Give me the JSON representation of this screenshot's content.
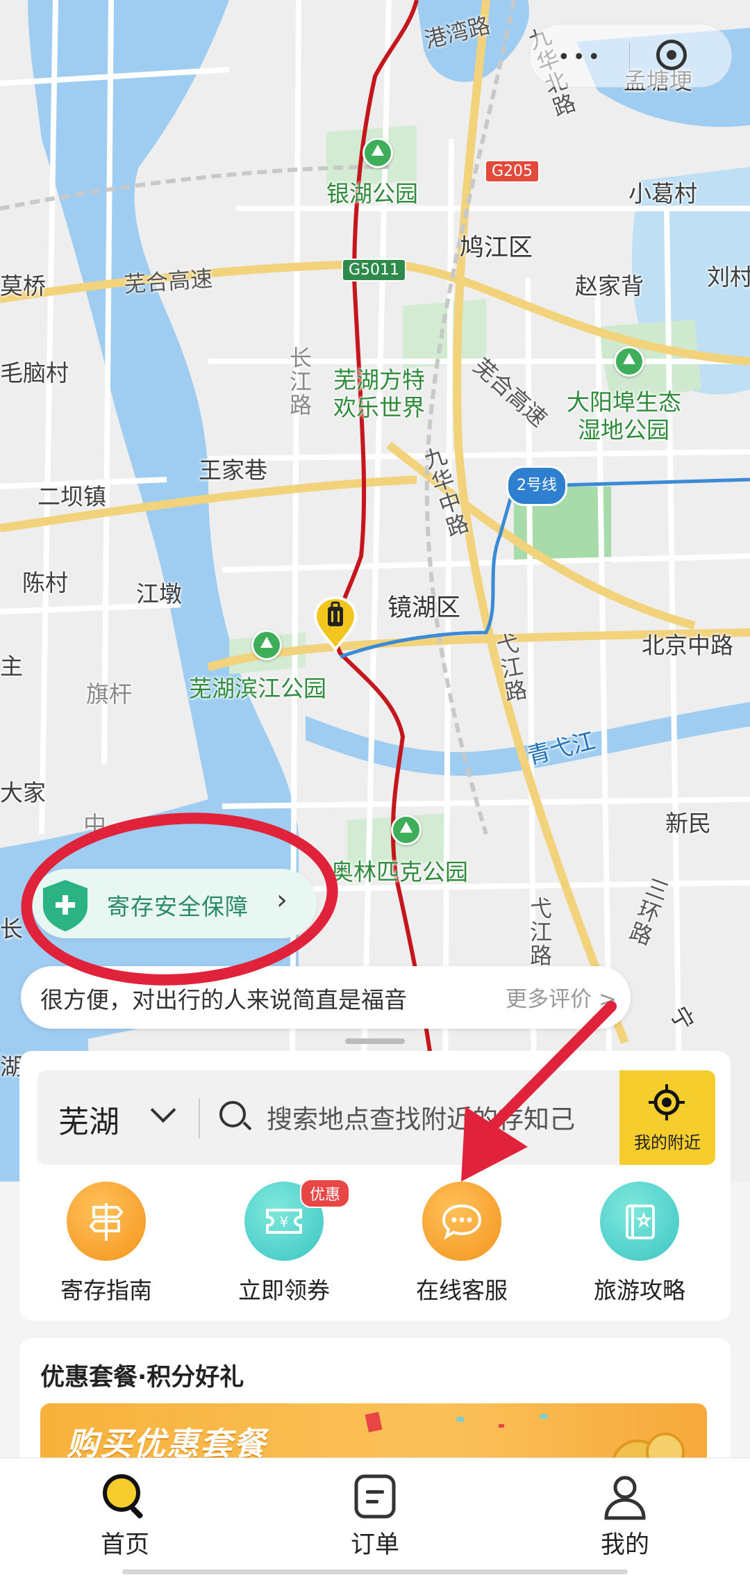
{
  "map": {
    "labels": {
      "ganwan_road": "港湾路",
      "jiuhua_north": "九华北路",
      "menggangdi": "孟塘埂",
      "yinhu_park": "银湖公园",
      "g205": "G205",
      "xiaogecun": "小葛村",
      "jiujiang_district": "鸠江区",
      "mo_qiao": "莫桥",
      "wuhe_highway": "芜合高速",
      "g5011": "G5011",
      "zhaojiabei": "赵家背",
      "liucun": "刘村",
      "maonao_cun": "毛脑村",
      "changjiang_road": "长江路",
      "fangte": "芜湖方特",
      "fangte2": "欢乐世界",
      "wuhe_highway2": "芜合高速",
      "dayangbu": "大阳埠生态",
      "dayangbu2": "湿地公园",
      "wangjiaxiang": "王家巷",
      "erba_town": "二坝镇",
      "jiuhua_middle": "九华中路",
      "metro_line2": "2号线",
      "chencun": "陈村",
      "jiangdun": "江墩",
      "jinghu_district": "镜湖区",
      "beijing_middle": "北京中路",
      "zhu": "主",
      "qigan": "旗杆",
      "binjiang_park": "芜湖滨江公园",
      "yijiang_road": "弋江路",
      "qingyi_river": "青弋江",
      "dajia": "大家",
      "xinmin": "新民",
      "olympic_park": "奥林匹克公园",
      "yijiang_road2": "弋江路",
      "third_ring": "三环路",
      "zhong": "中",
      "chang": "长",
      "ning": "宁",
      "xu": "湖"
    }
  },
  "insurance": {
    "label": "寄存安全保障"
  },
  "review": {
    "text": "很方便，对出行的人来说简直是福音",
    "more": "更多评价 >"
  },
  "search": {
    "city": "芜湖",
    "placeholder": "搜索地点查找附近的存知己",
    "nearby_label": "我的附近"
  },
  "features": [
    {
      "label": "寄存指南"
    },
    {
      "label": "立即领券",
      "badge": "优惠"
    },
    {
      "label": "在线客服"
    },
    {
      "label": "旅游攻略"
    }
  ],
  "promo": {
    "title": "优惠套餐·积分好礼",
    "banner_text": "购买优惠套餐"
  },
  "tabs": [
    {
      "label": "首页"
    },
    {
      "label": "订单"
    },
    {
      "label": "我的"
    }
  ],
  "colors": {
    "accent_yellow": "#f5ce2e",
    "annotation_red": "#e0233a",
    "feature_orange": "#f4941c",
    "feature_teal": "#3cc5c4"
  }
}
